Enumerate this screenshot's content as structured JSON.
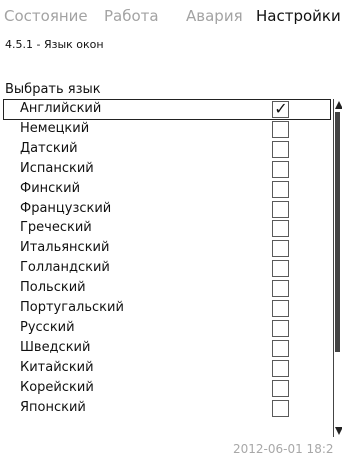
{
  "tabs": [
    {
      "label": "Состояние",
      "active": false
    },
    {
      "label": "Работа",
      "active": false
    },
    {
      "label": "Авария",
      "active": false
    },
    {
      "label": "Настройки",
      "active": true
    }
  ],
  "screen": {
    "title": "4.5.1 - Язык окон",
    "section_label": "Выбрать язык"
  },
  "languages": [
    {
      "label": "Английский",
      "checked": true,
      "selected": true
    },
    {
      "label": "Немецкий",
      "checked": false,
      "selected": false
    },
    {
      "label": "Датский",
      "checked": false,
      "selected": false
    },
    {
      "label": "Испанский",
      "checked": false,
      "selected": false
    },
    {
      "label": "Финский",
      "checked": false,
      "selected": false
    },
    {
      "label": "Французский",
      "checked": false,
      "selected": false
    },
    {
      "label": "Греческий",
      "checked": false,
      "selected": false
    },
    {
      "label": "Итальянский",
      "checked": false,
      "selected": false
    },
    {
      "label": "Голландский",
      "checked": false,
      "selected": false
    },
    {
      "label": "Польский",
      "checked": false,
      "selected": false
    },
    {
      "label": "Португальский",
      "checked": false,
      "selected": false
    },
    {
      "label": "Русский",
      "checked": false,
      "selected": false
    },
    {
      "label": "Шведский",
      "checked": false,
      "selected": false
    },
    {
      "label": "Китайский",
      "checked": false,
      "selected": false
    },
    {
      "label": "Корейский",
      "checked": false,
      "selected": false
    },
    {
      "label": "Японский",
      "checked": false,
      "selected": false
    }
  ],
  "checkmark_glyph": "✓",
  "status": {
    "timestamp": "2012-06-01 18:2"
  }
}
